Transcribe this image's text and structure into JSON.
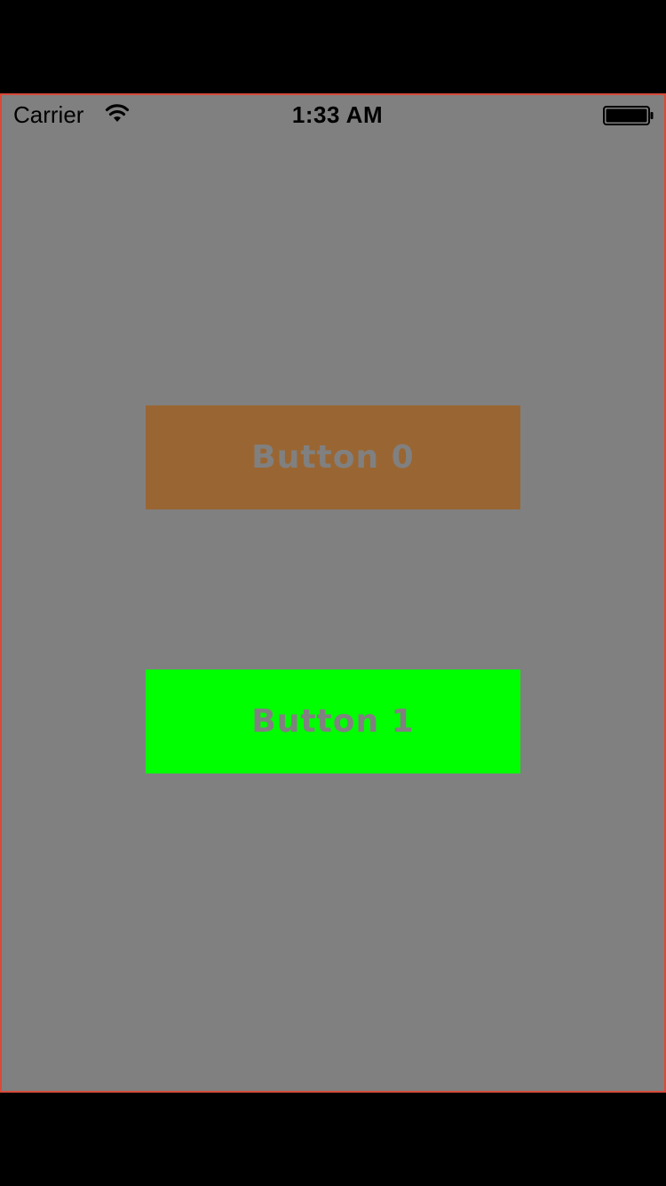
{
  "status_bar": {
    "carrier": "Carrier",
    "time": "1:33 AM",
    "wifi_icon": "wifi-icon",
    "battery_icon": "battery-icon"
  },
  "buttons": [
    {
      "label": "Button 0",
      "color": "#996633"
    },
    {
      "label": "Button 1",
      "color": "#00ff00"
    }
  ],
  "colors": {
    "background": "#808080",
    "button_text": "#808080",
    "frame_border": "#d84a3a"
  }
}
